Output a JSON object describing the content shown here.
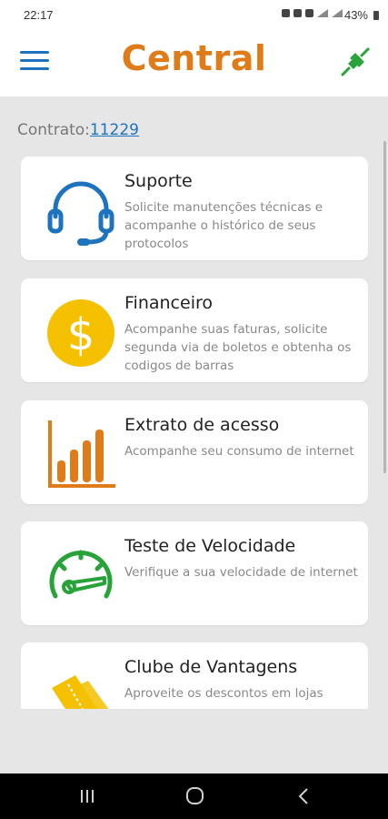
{
  "status_bar": {
    "time": "22:17",
    "battery": "43%"
  },
  "header": {
    "title": "Central",
    "title_color": "#e07b1a",
    "menu_icon": "hamburger-menu-icon",
    "connection_icon": "plug-icon"
  },
  "contract": {
    "label": "Contrato:",
    "number": "11229"
  },
  "cards": [
    {
      "title": "Suporte",
      "description": "Solicite manutenções técnicas e acompanhe o histórico de seus protocolos",
      "icon": "headset-icon"
    },
    {
      "title": "Financeiro",
      "description": "Acompanhe suas faturas, solicite segunda via de boletos e obtenha os codigos de barras",
      "icon": "dollar-coin-icon"
    },
    {
      "title": "Extrato de acesso",
      "description": "Acompanhe seu consumo de internet",
      "icon": "bar-chart-icon"
    },
    {
      "title": "Teste de Velocidade",
      "description": "Verifique a sua velocidade de internet",
      "icon": "speedometer-icon"
    },
    {
      "title": "Clube de Vantagens",
      "description": "Aproveite os descontos em lojas",
      "icon": "tickets-icon"
    }
  ],
  "colors": {
    "blue": "#1e73be",
    "orange": "#e07b1a",
    "yellow": "#f5c000",
    "green": "#27a33a",
    "background": "#e6e6e6"
  },
  "nav_bar": {
    "recents": "recent-apps-icon",
    "home": "home-icon",
    "back": "back-icon"
  }
}
